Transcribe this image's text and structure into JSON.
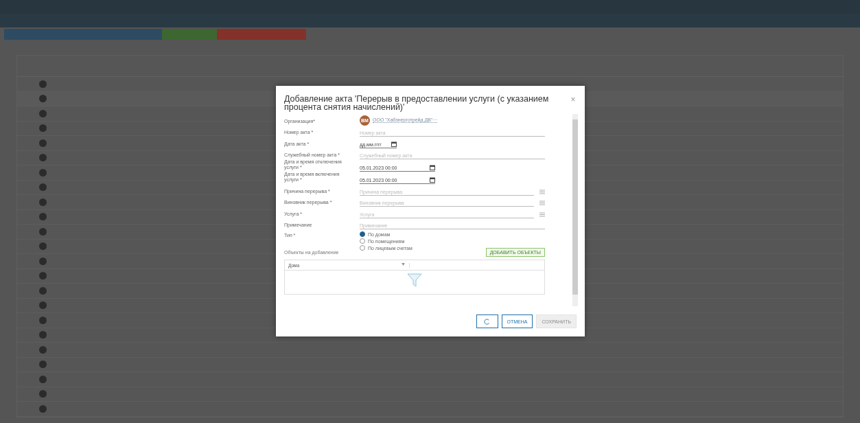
{
  "dialog": {
    "close": "×",
    "title": "Добавление акта 'Перерыв в предоставлении услуги (с указанием процента снятия начислений)'",
    "fields": [
      {
        "kind": "org",
        "label": "Организация*",
        "avatar": "ВМ",
        "value": "ООО \"Хабэнерготрейд ДВ\"···"
      },
      {
        "kind": "text",
        "label": "Номер акта *",
        "placeholder": "Номер акта"
      },
      {
        "kind": "date",
        "label": "Дата акта *",
        "value": "дд.мм.гггг"
      },
      {
        "kind": "text",
        "label": "Служебный номер акта *",
        "placeholder": "Служебный номер акта"
      },
      {
        "kind": "date",
        "label": "Дата и время отключения услуги *",
        "value": "05.01.2023 00:00"
      },
      {
        "kind": "date",
        "label": "Дата и время включения услуги *",
        "value": "05.01.2023 00:00"
      },
      {
        "kind": "list",
        "label": "Причина перерыва *",
        "placeholder": "Причина перерыва"
      },
      {
        "kind": "list",
        "label": "Виновник перерыва *",
        "placeholder": "Виновник перерыва"
      },
      {
        "kind": "list",
        "label": "Услуга *",
        "placeholder": "Услуга"
      },
      {
        "kind": "text",
        "label": "Примечание",
        "placeholder": "Примечание"
      },
      {
        "kind": "radio",
        "label": "Тип *",
        "options": [
          {
            "label": "По домам",
            "selected": true
          },
          {
            "label": "По помещениям",
            "selected": false
          },
          {
            "label": "По лицевым счетам",
            "selected": false
          }
        ]
      }
    ],
    "objects": {
      "label": "Объекты на добавление",
      "add_button": "ДОБАВИТЬ ОБЪЕКТЫ",
      "columns": [
        "Дома"
      ]
    },
    "buttons": {
      "cancel": "ОТМЕНА",
      "save": "СОХРАНИТЬ",
      "save_disabled": true
    }
  }
}
